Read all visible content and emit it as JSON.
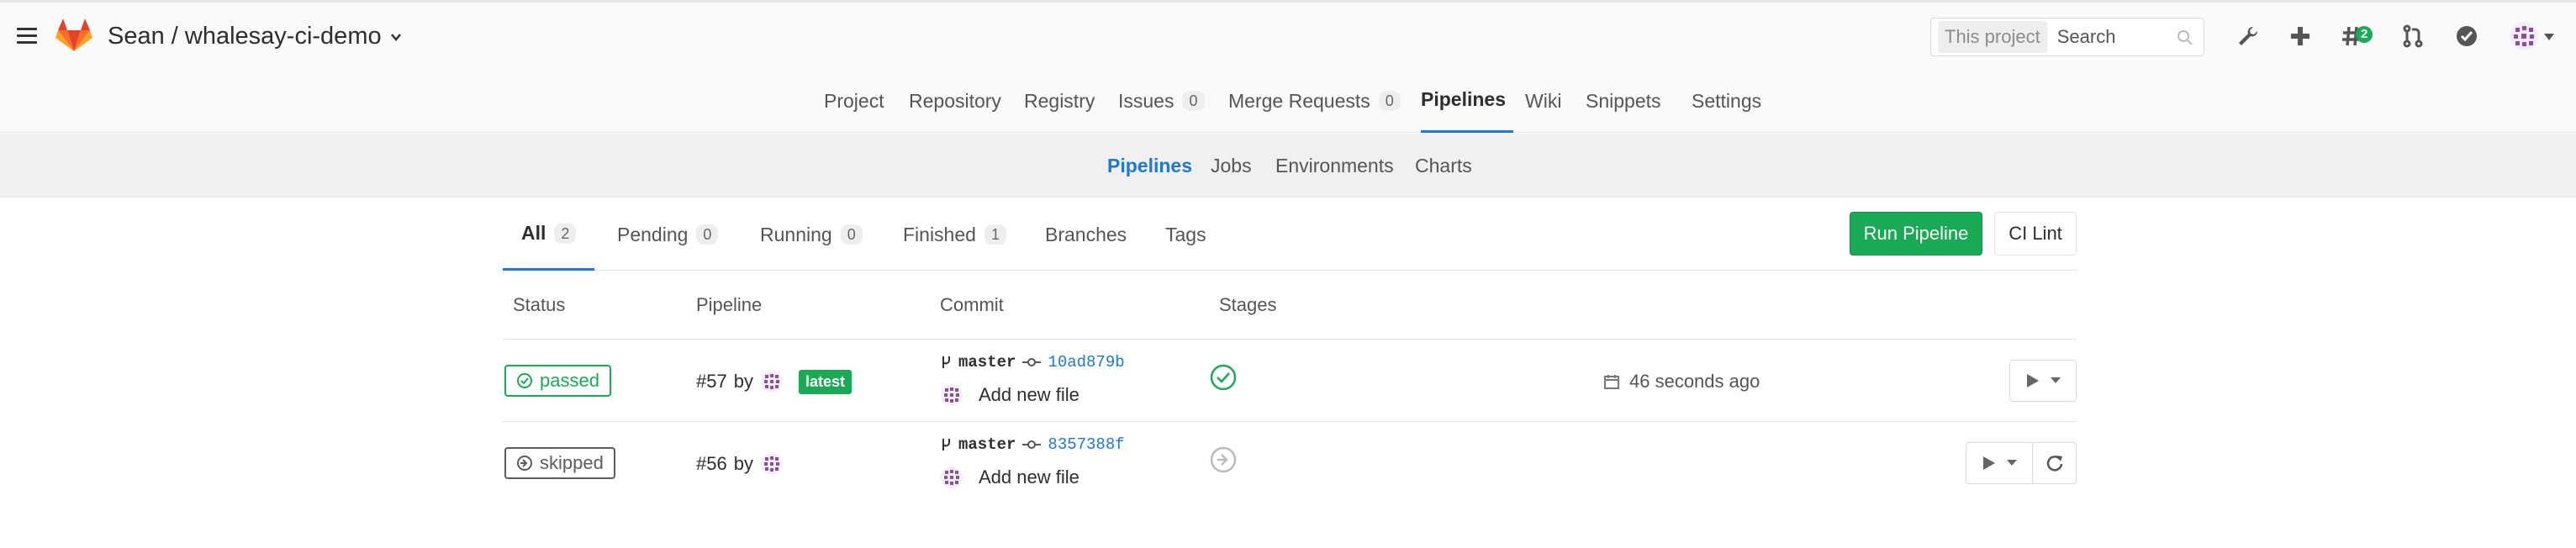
{
  "header": {
    "project_title": "Sean / whalesay-ci-demo",
    "search": {
      "scope": "This project",
      "placeholder": "Search"
    },
    "todo_count": "2"
  },
  "project_nav": [
    {
      "label": "Project"
    },
    {
      "label": "Repository"
    },
    {
      "label": "Registry"
    },
    {
      "label": "Issues",
      "count": "0"
    },
    {
      "label": "Merge Requests",
      "count": "0"
    },
    {
      "label": "Pipelines",
      "active": true
    },
    {
      "label": "Wiki"
    },
    {
      "label": "Snippets"
    },
    {
      "label": "Settings"
    }
  ],
  "sub_nav": [
    {
      "label": "Pipelines",
      "active": true
    },
    {
      "label": "Jobs"
    },
    {
      "label": "Environments"
    },
    {
      "label": "Charts"
    }
  ],
  "tabs": [
    {
      "label": "All",
      "count": "2",
      "active": true
    },
    {
      "label": "Pending",
      "count": "0"
    },
    {
      "label": "Running",
      "count": "0"
    },
    {
      "label": "Finished",
      "count": "1"
    },
    {
      "label": "Branches"
    },
    {
      "label": "Tags"
    }
  ],
  "actions": {
    "run_pipeline": "Run Pipeline",
    "ci_lint": "CI Lint"
  },
  "table": {
    "headers": [
      "Status",
      "Pipeline",
      "Commit",
      "Stages"
    ],
    "rows": [
      {
        "status": "passed",
        "pipeline": "#57",
        "by": "by",
        "badge": "latest",
        "branch": "master",
        "sha": "10ad879b",
        "message": "Add new file",
        "time": "46 seconds ago"
      },
      {
        "status": "skipped",
        "pipeline": "#56",
        "by": "by",
        "branch": "master",
        "sha": "8357388f",
        "message": "Add new file"
      }
    ]
  },
  "colors": {
    "accent": "#1f78d1",
    "success": "#1aaa55",
    "skipped": "#5c5c5c",
    "brand_orange": "#e24329"
  }
}
